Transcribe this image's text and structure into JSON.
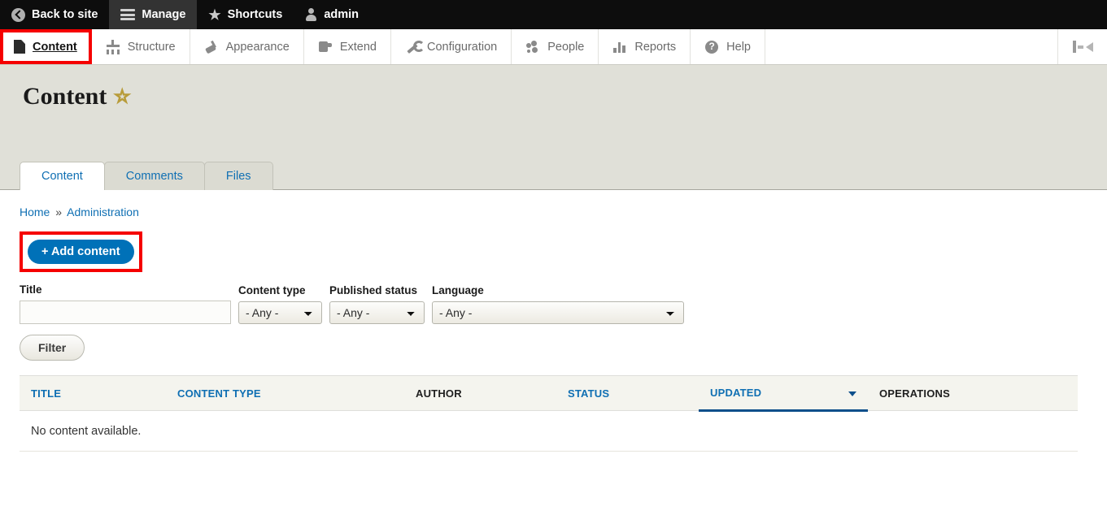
{
  "toolbar": {
    "back_to_site": "Back to site",
    "manage": "Manage",
    "shortcuts": "Shortcuts",
    "user": "admin"
  },
  "menu": {
    "items": [
      {
        "label": "Content",
        "icon": "document-icon"
      },
      {
        "label": "Structure",
        "icon": "structure-icon"
      },
      {
        "label": "Appearance",
        "icon": "paintbrush-icon"
      },
      {
        "label": "Extend",
        "icon": "puzzle-icon"
      },
      {
        "label": "Configuration",
        "icon": "wrench-icon"
      },
      {
        "label": "People",
        "icon": "people-icon"
      },
      {
        "label": "Reports",
        "icon": "bar-chart-icon"
      },
      {
        "label": "Help",
        "icon": "question-mark-icon"
      }
    ],
    "tray_toggle_icon": "toolbar-orientation-icon"
  },
  "page": {
    "title": "Content",
    "shortcut_star": "☆"
  },
  "tabs": [
    {
      "label": "Content",
      "active": true
    },
    {
      "label": "Comments",
      "active": false
    },
    {
      "label": "Files",
      "active": false
    }
  ],
  "breadcrumb": {
    "home": "Home",
    "separator": "»",
    "current": "Administration"
  },
  "actions": {
    "add_content": "+ Add content"
  },
  "filters": {
    "title_label": "Title",
    "title_value": "",
    "title_placeholder": "",
    "content_type_label": "Content type",
    "content_type_value": "- Any -",
    "published_status_label": "Published status",
    "published_status_value": "- Any -",
    "language_label": "Language",
    "language_value": "- Any -",
    "any_option": "- Any -",
    "filter_button": "Filter"
  },
  "table": {
    "columns": [
      {
        "label": "TITLE",
        "sortable": true,
        "sorted": false
      },
      {
        "label": "CONTENT TYPE",
        "sortable": true,
        "sorted": false
      },
      {
        "label": "AUTHOR",
        "sortable": false,
        "sorted": false
      },
      {
        "label": "STATUS",
        "sortable": true,
        "sorted": false
      },
      {
        "label": "UPDATED",
        "sortable": true,
        "sorted": true
      },
      {
        "label": "OPERATIONS",
        "sortable": false,
        "sorted": false
      }
    ],
    "sort_direction": "desc",
    "rows": [],
    "empty_message": "No content available."
  },
  "annotations": {
    "highlight_color": "#f50000",
    "targets": [
      "content-menu-tab",
      "add-content-button"
    ]
  },
  "colors": {
    "toolbar_bg": "#0d0d0d",
    "header_band": "#e0e0d8",
    "link_blue": "#0f6fb3",
    "button_blue": "#0071b8",
    "sort_underline": "#0d4f8b"
  }
}
